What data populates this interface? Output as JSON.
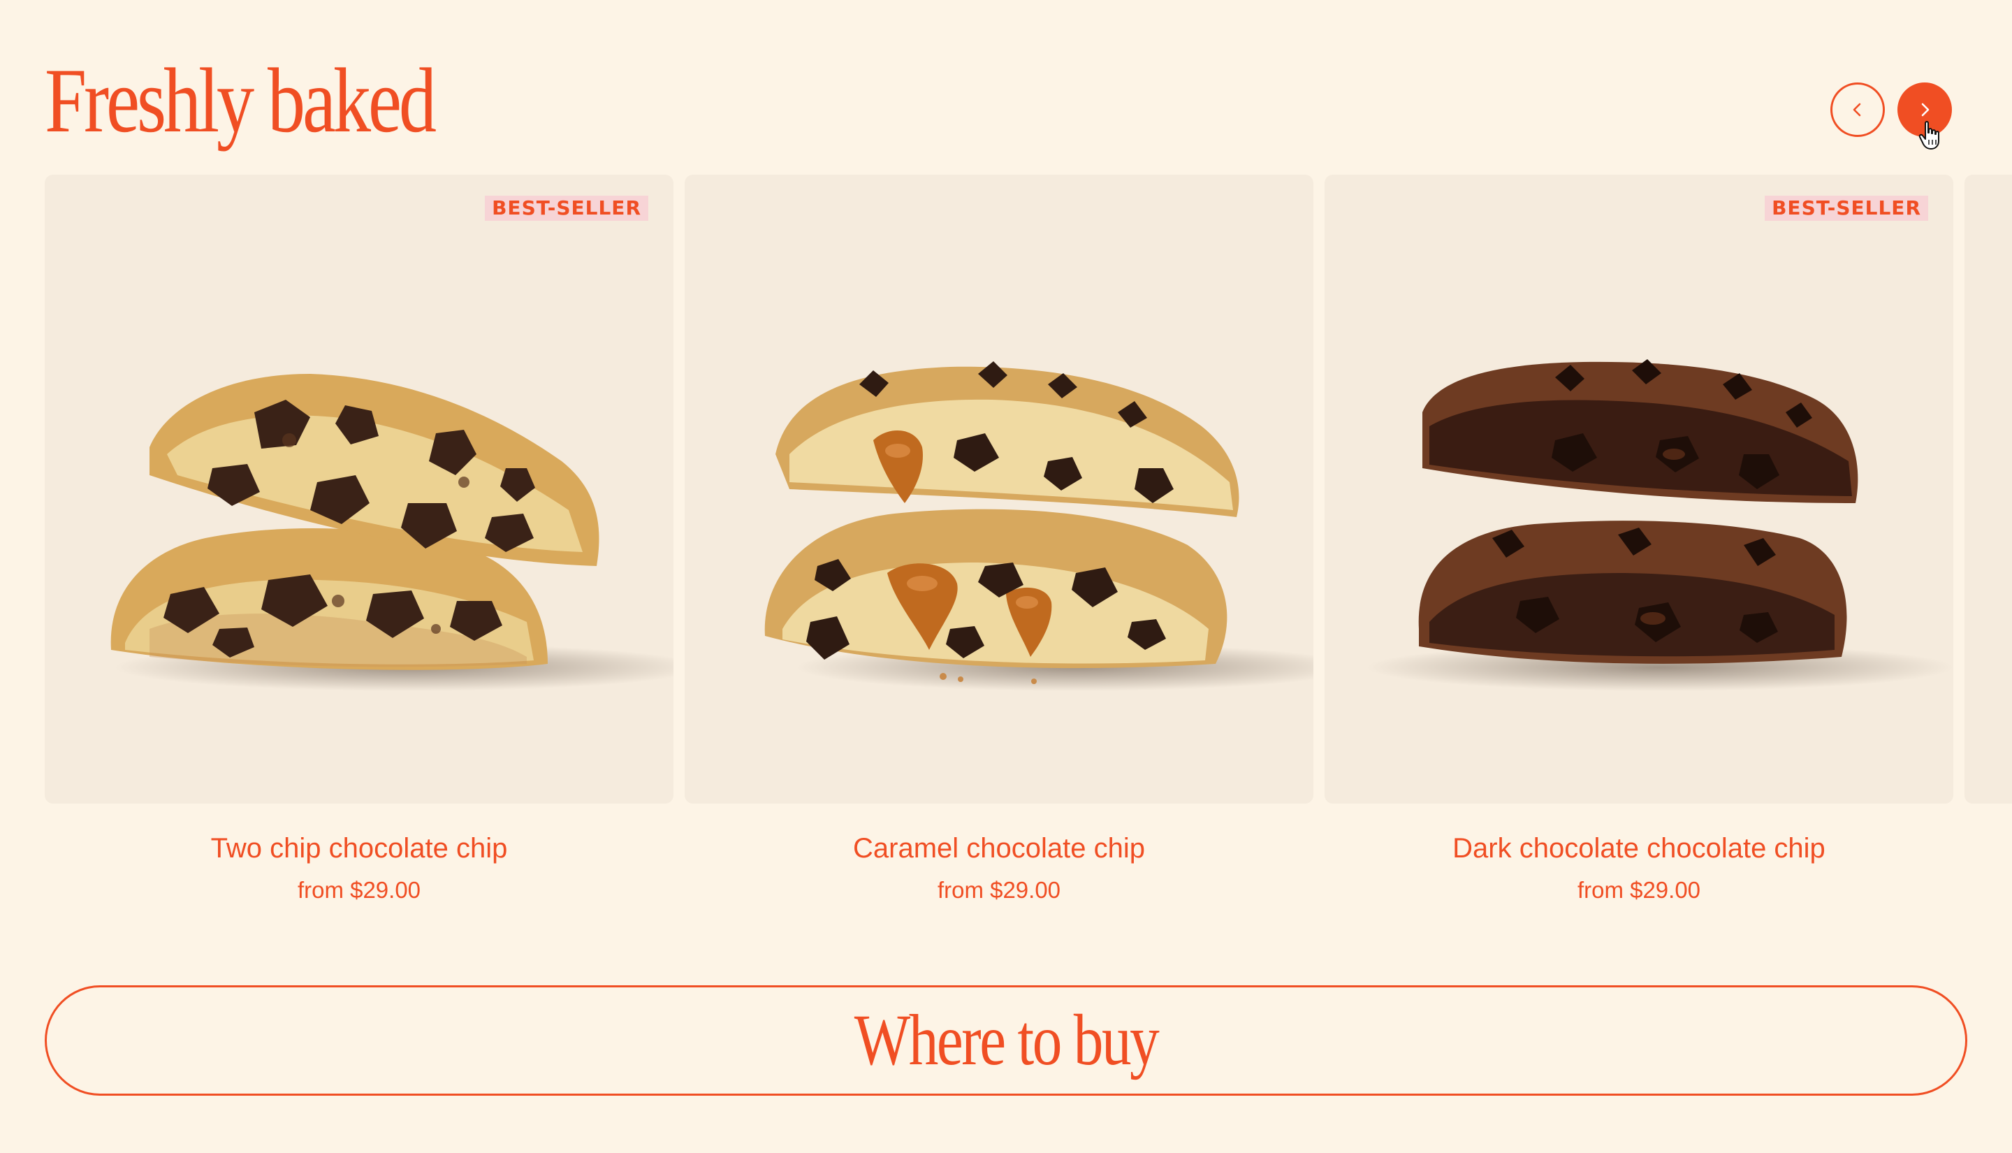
{
  "section": {
    "title": "Freshly baked"
  },
  "carousel": {
    "prev_icon": "chevron-left-icon",
    "next_icon": "chevron-right-icon",
    "products": [
      {
        "name": "Two chip chocolate chip",
        "price": "from $29.00",
        "badge": "BEST-SELLER",
        "image": "cookie-two-chip-photo"
      },
      {
        "name": "Caramel chocolate chip",
        "price": "from $29.00",
        "badge": "",
        "image": "cookie-caramel-photo"
      },
      {
        "name": "Dark chocolate chocolate chip",
        "price": "from $29.00",
        "badge": "BEST-SELLER",
        "image": "cookie-dark-chocolate-photo"
      }
    ]
  },
  "cta": {
    "label": "Where to buy"
  },
  "colors": {
    "accent": "#f04e23",
    "background": "#fdf4e6",
    "card_background": "#f5ebdd",
    "badge_background": "#f7d4d6"
  }
}
